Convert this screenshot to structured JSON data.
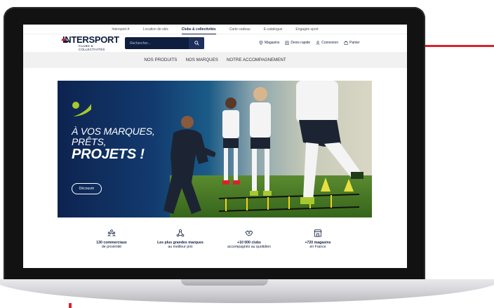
{
  "util_nav": [
    {
      "label": "Intersport.fr",
      "active": false
    },
    {
      "label": "Location de skis",
      "active": false
    },
    {
      "label": "Clubs & collectivités",
      "active": true
    },
    {
      "label": "Carte cadeau",
      "active": false
    },
    {
      "label": "E-catalogue",
      "active": false
    },
    {
      "label": "Engagés sport",
      "active": false
    }
  ],
  "logo": {
    "main": "INTERSPORT",
    "sub": "CLUBS & COLLECTIVITÉS"
  },
  "search": {
    "placeholder": "Rechercher..."
  },
  "header_links": {
    "stores": "Magasins",
    "quote": "Devis rapide",
    "login": "Connexion",
    "cart": "Panier"
  },
  "main_nav": [
    "NOS PRODUITS",
    "NOS MARQUES",
    "NOTRE ACCOMPAGNEMENT"
  ],
  "hero": {
    "line1": "À VOS MARQUES,",
    "line2": "PRÊTS,",
    "line3": "PROJETS !",
    "button": "Découvrir"
  },
  "features": [
    {
      "icon": "people-group-icon",
      "line1": "130 commerciaux",
      "line2": "de proximité"
    },
    {
      "icon": "network-icon",
      "line1": "Les plus grandes marques",
      "line2": "au meilleur prix"
    },
    {
      "icon": "handshake-icon",
      "line1": "+10 000 clubs",
      "line2": "accompagnés au quotidien"
    },
    {
      "icon": "storefront-icon",
      "line1": "+720 magasins",
      "line2": "en France"
    }
  ],
  "colors": {
    "navy": "#0f1e3e",
    "red": "#d8232a",
    "accent": "#a6c92e"
  }
}
